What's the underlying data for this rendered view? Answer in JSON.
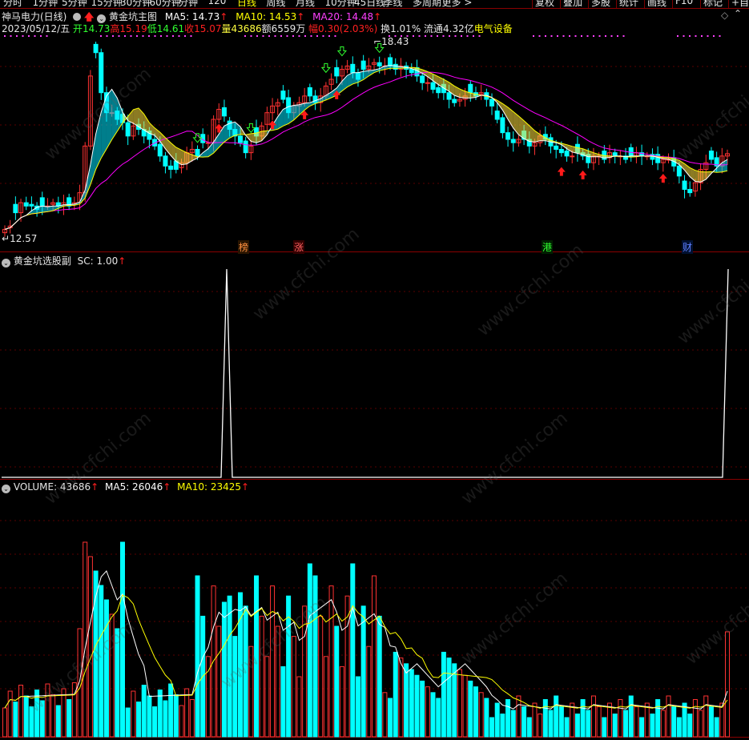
{
  "toolbar": {
    "items": [
      "分时",
      "1分钟",
      "5分钟",
      "15分钟",
      "30分钟",
      "60分钟",
      "分钟",
      "120",
      "日线",
      "周线",
      "月线",
      "10分钟",
      "45日线",
      "季线",
      "多周期",
      "更多 >"
    ],
    "active": "日线",
    "right_items": [
      "复权",
      "叠加",
      "多股",
      "统计",
      "画线",
      "F10",
      "标记",
      "+自选"
    ]
  },
  "main_panel": {
    "stock_name": "神马电力(日线)",
    "indicator_name": "黄金坑主图",
    "ma5": "MA5: 14.73",
    "ma10": "MA10: 14.53",
    "ma20": "MA20: 14.48",
    "info": {
      "date": "2023/05/12/五",
      "open": "开14.73",
      "high": "高15.19",
      "low": "低14.61",
      "close": "收15.07",
      "vol": "量43686",
      "amount": "额6559万",
      "change": "幅0.30(2.03%)",
      "turnover": "换1.01%",
      "float": "流通4.32亿",
      "sector": "电气设备"
    },
    "high_label": "18.43",
    "low_label": "12.57",
    "markers": [
      "榜",
      "涨",
      "港",
      "财"
    ]
  },
  "sub_panel": {
    "indicator_name": "黄金坑选股副",
    "sc": "SC: 1.00"
  },
  "vol_panel": {
    "volume": "VOLUME: 43686",
    "ma5": "MA5: 26046",
    "ma10": "MA10: 23425"
  },
  "watermark": "www.cfchi.com",
  "colors": {
    "up": "#ff3232",
    "down": "#00ffff",
    "ma5": "#ffffff",
    "ma10": "#ffff00",
    "ma20": "#ff00ff",
    "grid": "#8a0000",
    "sector": "#ffff00"
  },
  "chart_data": {
    "type": "candlestick",
    "price_range": [
      12.57,
      18.43
    ],
    "closes": [
      12.8,
      12.9,
      13.3,
      13.6,
      13.5,
      13.5,
      13.4,
      13.5,
      13.5,
      13.6,
      13.5,
      13.6,
      13.5,
      13.6,
      13.9,
      15.3,
      17.4,
      18.1,
      16.9,
      16.3,
      16.3,
      16.1,
      16.0,
      15.6,
      15.9,
      15.8,
      15.6,
      15.5,
      15.3,
      15.0,
      14.7,
      14.6,
      14.6,
      14.8,
      15.1,
      15.2,
      15.0,
      15.4,
      15.4,
      16.1,
      16.4,
      16.2,
      15.8,
      15.6,
      15.4,
      15.1,
      15.3,
      15.6,
      15.9,
      16.3,
      16.5,
      16.6,
      16.7,
      16.3,
      16.5,
      16.6,
      16.8,
      16.8,
      16.6,
      16.8,
      17.1,
      17.3,
      17.4,
      17.6,
      17.7,
      17.5,
      17.3,
      17.6,
      17.7,
      17.8,
      17.7,
      17.7,
      17.7,
      17.6,
      17.7,
      17.6,
      17.5,
      17.4,
      17.2,
      17.2,
      17.0,
      16.9,
      16.9,
      16.7,
      16.6,
      16.7,
      16.8,
      16.9,
      16.8,
      16.9,
      16.7,
      16.5,
      16.1,
      15.7,
      15.5,
      15.4,
      15.5,
      15.5,
      15.3,
      15.4,
      15.6,
      15.5,
      15.3,
      15.2,
      15.1,
      15.0,
      15.0,
      15.1,
      15.0,
      14.8,
      15.0,
      15.0,
      14.9,
      15.1,
      15.0,
      15.0,
      14.9,
      15.0,
      15.1,
      15.0,
      15.0,
      14.9,
      14.8,
      14.9,
      14.9,
      14.7,
      14.4,
      14.0,
      13.9,
      14.2,
      14.6,
      14.8,
      14.9,
      14.7,
      15.0,
      15.07
    ],
    "volume_range": [
      0,
      100000
    ],
    "sc_peaks": [
      0.0,
      1.0,
      0.0,
      1.0
    ]
  }
}
